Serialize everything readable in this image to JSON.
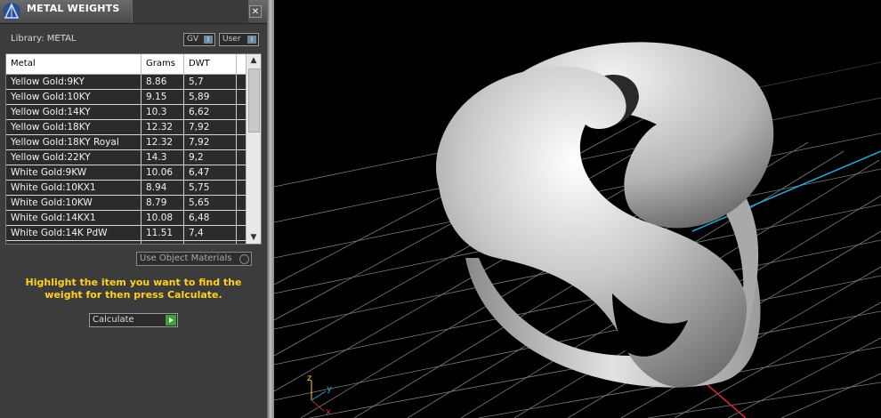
{
  "panel": {
    "title": "METAL WEIGHTS",
    "close_glyph": "✕",
    "library_label": "Library: METAL",
    "toggle_gv": "GV",
    "toggle_user": "User",
    "toggle_icon": "i",
    "columns": [
      "Metal",
      "Grams",
      "DWT"
    ],
    "rows": [
      {
        "metal": "Yellow Gold:9KY",
        "grams": "8.86",
        "dwt": "5,7"
      },
      {
        "metal": "Yellow Gold:10KY",
        "grams": "9.15",
        "dwt": "5,89"
      },
      {
        "metal": "Yellow Gold:14KY",
        "grams": "10.3",
        "dwt": "6,62"
      },
      {
        "metal": "Yellow Gold:18KY",
        "grams": "12.32",
        "dwt": "7,92"
      },
      {
        "metal": "Yellow Gold:18KY Royal",
        "grams": "12.32",
        "dwt": "7,92"
      },
      {
        "metal": "Yellow Gold:22KY",
        "grams": "14.3",
        "dwt": "9,2"
      },
      {
        "metal": "White Gold:9KW",
        "grams": "10.06",
        "dwt": "6,47"
      },
      {
        "metal": "White Gold:10KX1",
        "grams": "8.94",
        "dwt": "5,75"
      },
      {
        "metal": "White Gold:10KW",
        "grams": "8.79",
        "dwt": "5,65"
      },
      {
        "metal": "White Gold:14KX1",
        "grams": "10.08",
        "dwt": "6,48"
      },
      {
        "metal": "White Gold:14K PdW",
        "grams": "11.51",
        "dwt": "7,4"
      }
    ],
    "use_object_materials": "Use Object Materials",
    "hint": "Highlight the item you want to find the weight for then press Calculate.",
    "calculate_label": "Calculate"
  },
  "viewport": {
    "axis_labels": {
      "z": "z",
      "y": "y",
      "x": "x"
    },
    "background": "#000000",
    "grid_color": "#8a8a8a",
    "x_axis_color": "#d02a2a",
    "y_axis_color": "#2a9fd0",
    "accent_yellow": "#ffd21e"
  }
}
